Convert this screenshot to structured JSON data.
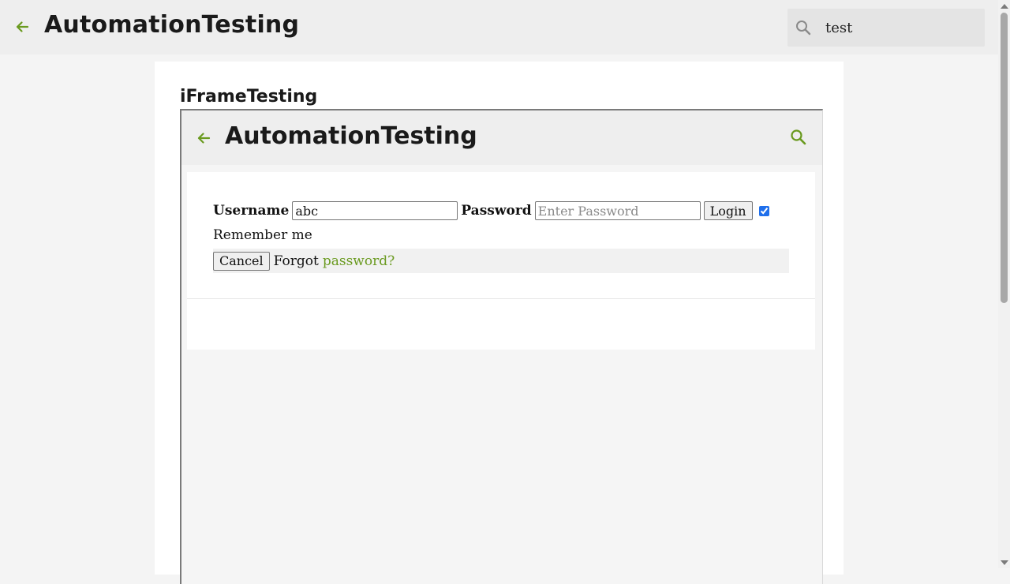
{
  "header": {
    "title": "AutomationTesting",
    "back_icon": "arrow-left-icon",
    "search": {
      "icon": "search-icon",
      "value": "test"
    }
  },
  "main": {
    "section_title": "iFrameTesting",
    "iframe": {
      "header": {
        "title": "AutomationTesting",
        "back_icon": "arrow-left-icon",
        "search_icon": "search-icon"
      },
      "login_form": {
        "username_label": "Username",
        "username_value": "abc",
        "password_label": "Password",
        "password_placeholder": "Enter Password",
        "login_button": "Login",
        "remember_checked": true,
        "remember_label": "Remember me",
        "cancel_button": "Cancel",
        "forgot_text": "Forgot",
        "forgot_link": "password?"
      }
    }
  },
  "colors": {
    "accent": "#6a9a1f",
    "header_bg": "#eeeeee",
    "page_bg": "#f4f4f4",
    "checkbox": "#1f6feb"
  }
}
